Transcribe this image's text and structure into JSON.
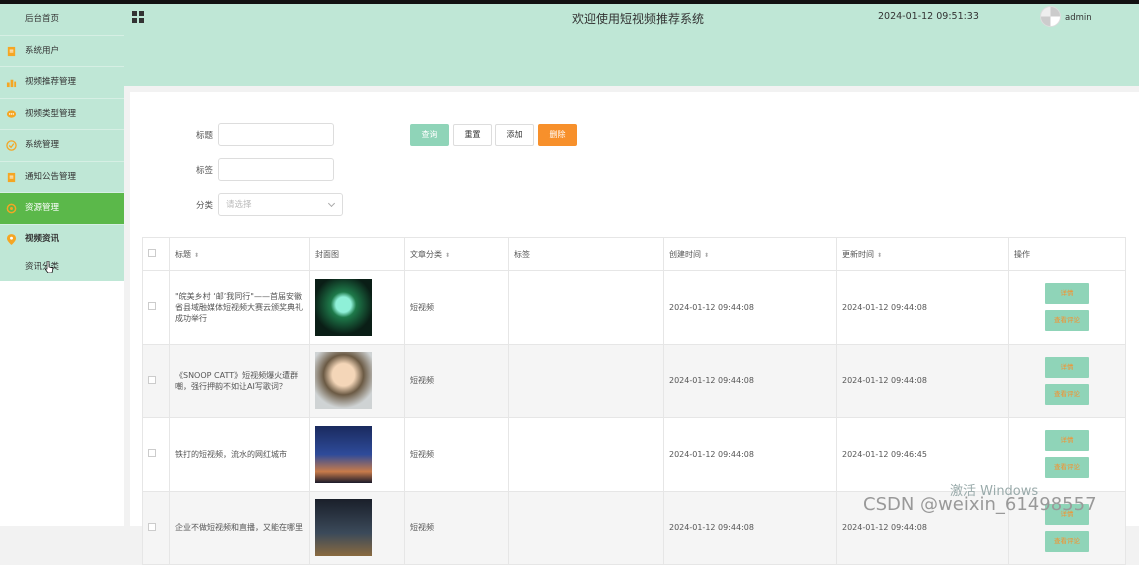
{
  "header": {
    "title": "欢迎使用短视频推荐系统",
    "datetime": "2024-01-12 09:51:33",
    "username": "admin"
  },
  "sidebar": {
    "home": "后台首页",
    "items": [
      {
        "label": "系统用户",
        "icon": "document-icon"
      },
      {
        "label": "视频推荐管理",
        "icon": "chart-icon"
      },
      {
        "label": "视频类型管理",
        "icon": "chat-icon"
      },
      {
        "label": "系统管理",
        "icon": "check-circle-icon"
      },
      {
        "label": "通知公告管理",
        "icon": "document-icon"
      },
      {
        "label": "资源管理",
        "icon": "gear-icon",
        "active": true
      }
    ],
    "sub_header": "视频资讯",
    "sub_item": "资讯分类"
  },
  "filters": {
    "title_label": "标题",
    "tag_label": "标签",
    "category_label": "分类",
    "category_placeholder": "请选择"
  },
  "buttons": {
    "search": "查询",
    "reset": "重置",
    "add": "添加",
    "delete": "删除"
  },
  "table": {
    "columns": [
      "标题",
      "封面图",
      "文章分类",
      "标签",
      "创建时间",
      "更新时间",
      "操作"
    ],
    "detail_label": "详情",
    "comment_label": "查看评论",
    "rows": [
      {
        "title": "\"皖美乡村 ‘邮’我同行\"——首届安徽省县域融媒体短视频大赛云颁奖典礼成功举行",
        "category": "短视频",
        "tag": "",
        "created": "2024-01-12 09:44:08",
        "updated": "2024-01-12 09:44:08"
      },
      {
        "title": "《SNOOP CATT》短视频爆火遭群嘲，强行押韵不如让AI写歌词？",
        "category": "短视频",
        "tag": "",
        "created": "2024-01-12 09:44:08",
        "updated": "2024-01-12 09:44:08"
      },
      {
        "title": "铁打的短视频，流水的网红城市",
        "category": "短视频",
        "tag": "",
        "created": "2024-01-12 09:44:08",
        "updated": "2024-01-12 09:46:45"
      },
      {
        "title": "企业不做短视频和直播，又能在哪里",
        "category": "短视频",
        "tag": "",
        "created": "2024-01-12 09:44:08",
        "updated": "2024-01-12 09:44:08"
      }
    ]
  },
  "watermark": {
    "activate": "激活 Windows",
    "csdn": "CSDN @weixin_61498557"
  }
}
